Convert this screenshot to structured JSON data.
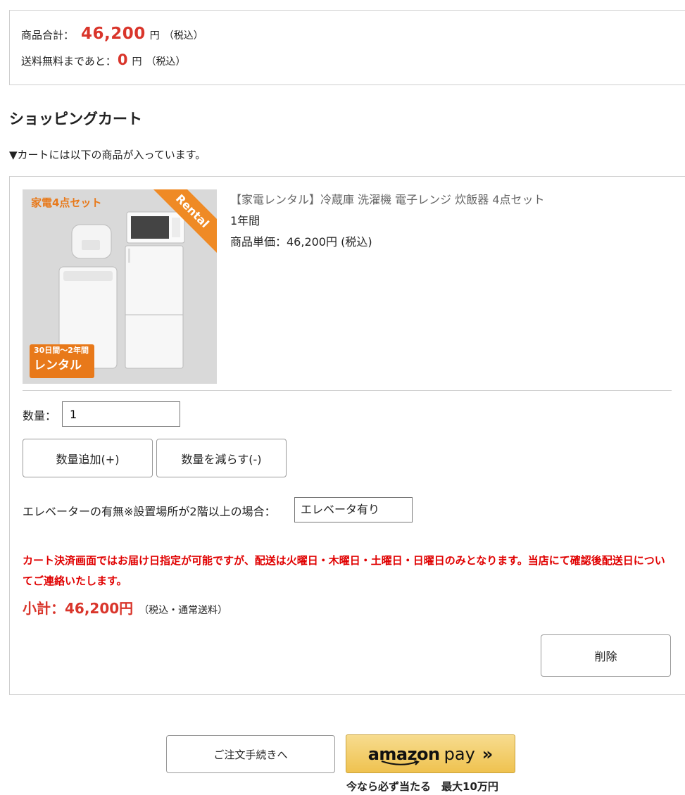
{
  "summary": {
    "total_label": "商品合計：",
    "total_amount": "46,200",
    "total_unit": "円",
    "total_tax": "（税込）",
    "free_shipping_label": "送料無料まであと：",
    "free_shipping_amount": "0",
    "free_shipping_unit": "円",
    "free_shipping_tax": "（税込）"
  },
  "cart": {
    "title": "ショッピングカート",
    "note": "▼カートには以下の商品が入っています。"
  },
  "item": {
    "image": {
      "badge": "家電4点セット",
      "ribbon": "Rental",
      "term_small": "30日間〜2年間",
      "term_big": "レンタル",
      "icons": [
        "rice-cooker-icon",
        "microwave-icon",
        "fridge-icon",
        "washing-machine-icon"
      ]
    },
    "name": "【家電レンタル】冷蔵庫 洗濯機 電子レンジ 炊飯器 4点セット",
    "term": "1年間",
    "unit_price": "商品単価：46,200円 (税込)",
    "quantity_label": "数量：",
    "quantity_value": "1",
    "add_label": "数量追加(+)",
    "sub_label": "数量を減らす(-)",
    "elevator_label": "エレベーターの有無※設置場所が2階以上の場合：",
    "elevator_value": "エレベータ有り",
    "notice": "カート決済画面ではお届け日指定が可能ですが、配送は火曜日・木曜日・土曜日・日曜日のみとなります。当店にて確認後配送日についてご連絡いたします。",
    "subtotal_label": "小計：46,200円",
    "subtotal_note": "（税込・通常送料）",
    "delete_label": "削除"
  },
  "checkout": {
    "order_label": "ご注文手続きへ",
    "amazon_brand": "amazon",
    "amazon_pay": "pay",
    "promo": "今なら必ず当たる　最大10万円"
  },
  "colors": {
    "accent_red": "#d9352b",
    "notice_red": "#e00000",
    "amazon_yellow": "#efc24f",
    "rental_orange": "#e8791a"
  }
}
